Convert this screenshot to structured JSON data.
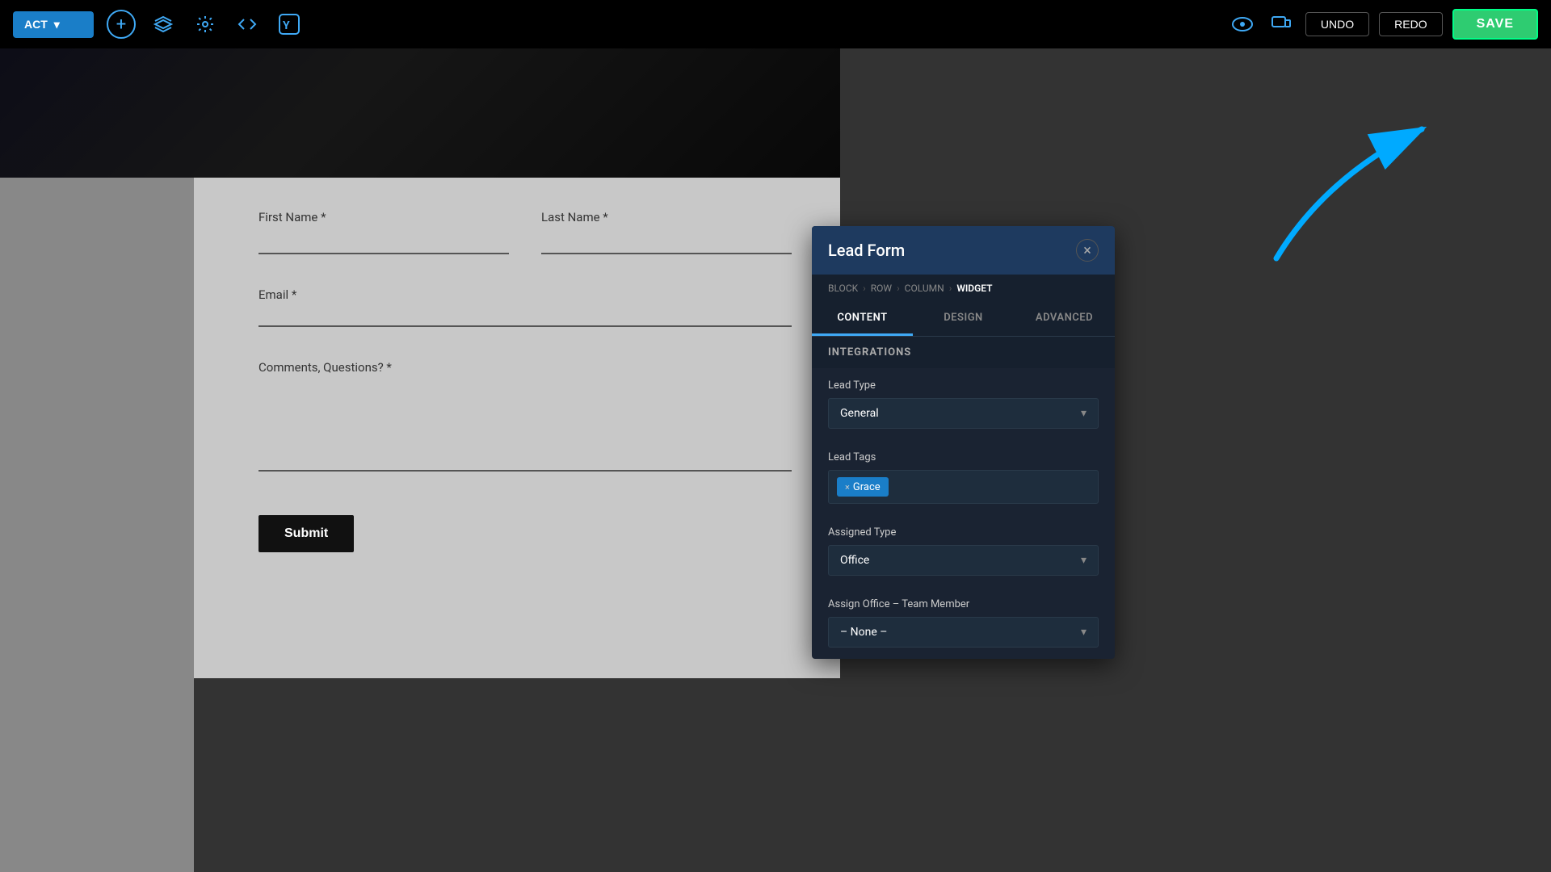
{
  "toolbar": {
    "page_label": "ACT",
    "add_icon": "+",
    "layers_icon": "⊞",
    "settings_icon": "⚙",
    "code_icon": "</>",
    "yoast_icon": "Y",
    "preview_icon": "👁",
    "responsive_icon": "⊡",
    "undo_label": "UNDO",
    "redo_label": "REDO",
    "save_label": "SAVE"
  },
  "breadcrumb": {
    "block": "BLOCK",
    "row": "ROW",
    "column": "COLUMN",
    "widget": "WIDGET"
  },
  "panel": {
    "title": "Lead Form",
    "close_icon": "×",
    "tabs": [
      {
        "label": "CONTENT",
        "active": true
      },
      {
        "label": "DESIGN",
        "active": false
      },
      {
        "label": "ADVANCED",
        "active": false
      }
    ],
    "section_header": "INTEGRATIONS",
    "lead_type_label": "Lead Type",
    "lead_type_value": "General",
    "lead_tags_label": "Lead Tags",
    "tag_grace": "Grace",
    "tag_remove": "×",
    "assigned_type_label": "Assigned Type",
    "assigned_type_value": "Office",
    "assign_office_label": "Assign Office – Team Member",
    "assign_office_value": "– None –"
  },
  "form": {
    "first_name_label": "First Name *",
    "last_name_label": "Last Name *",
    "email_label": "Email *",
    "comments_label": "Comments, Questions? *",
    "submit_label": "Submit"
  }
}
